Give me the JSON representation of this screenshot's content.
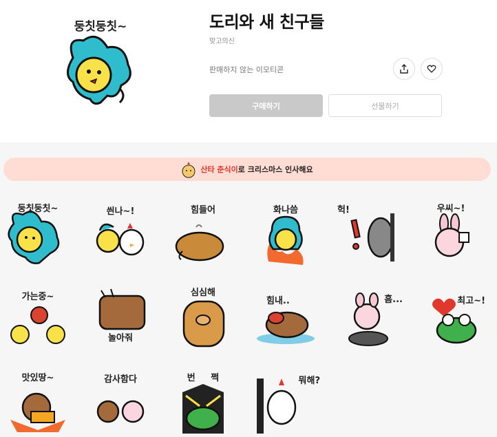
{
  "product": {
    "title": "도리와 새 친구들",
    "author": "맞고의신",
    "status": "판매하지 않는 이모티콘",
    "hero_caption": "둥칫둥칫~",
    "buy_label": "구매하기",
    "gift_label": "선물하기"
  },
  "banner": {
    "highlight": "산타 춘식이",
    "text": "로 크리스마스 인사해요"
  },
  "stickers": [
    {
      "caption": "둥칫둥칫~"
    },
    {
      "caption": "씐나~!"
    },
    {
      "caption": "힘들어"
    },
    {
      "caption": "화나씀"
    },
    {
      "caption": "헉!"
    },
    {
      "caption": "우씨~!"
    },
    {
      "caption": "가는중~"
    },
    {
      "caption": "놀아줘"
    },
    {
      "caption": "심심해"
    },
    {
      "caption": "힘내.."
    },
    {
      "caption": "흠..."
    },
    {
      "caption": "최고~!"
    },
    {
      "caption": "맛있땅~"
    },
    {
      "caption": "감사함다"
    },
    {
      "caption": "번     쩍"
    },
    {
      "caption": "뭐해?"
    }
  ],
  "colors": {
    "banner_bg": "#ffdcd4",
    "banner_highlight": "#e0382c",
    "buy_bg": "#c9c9c9",
    "dori_teal": "#2fbccc",
    "dori_yellow": "#f9e14a"
  },
  "icons": {
    "share": "share-icon",
    "like": "heart-icon"
  }
}
